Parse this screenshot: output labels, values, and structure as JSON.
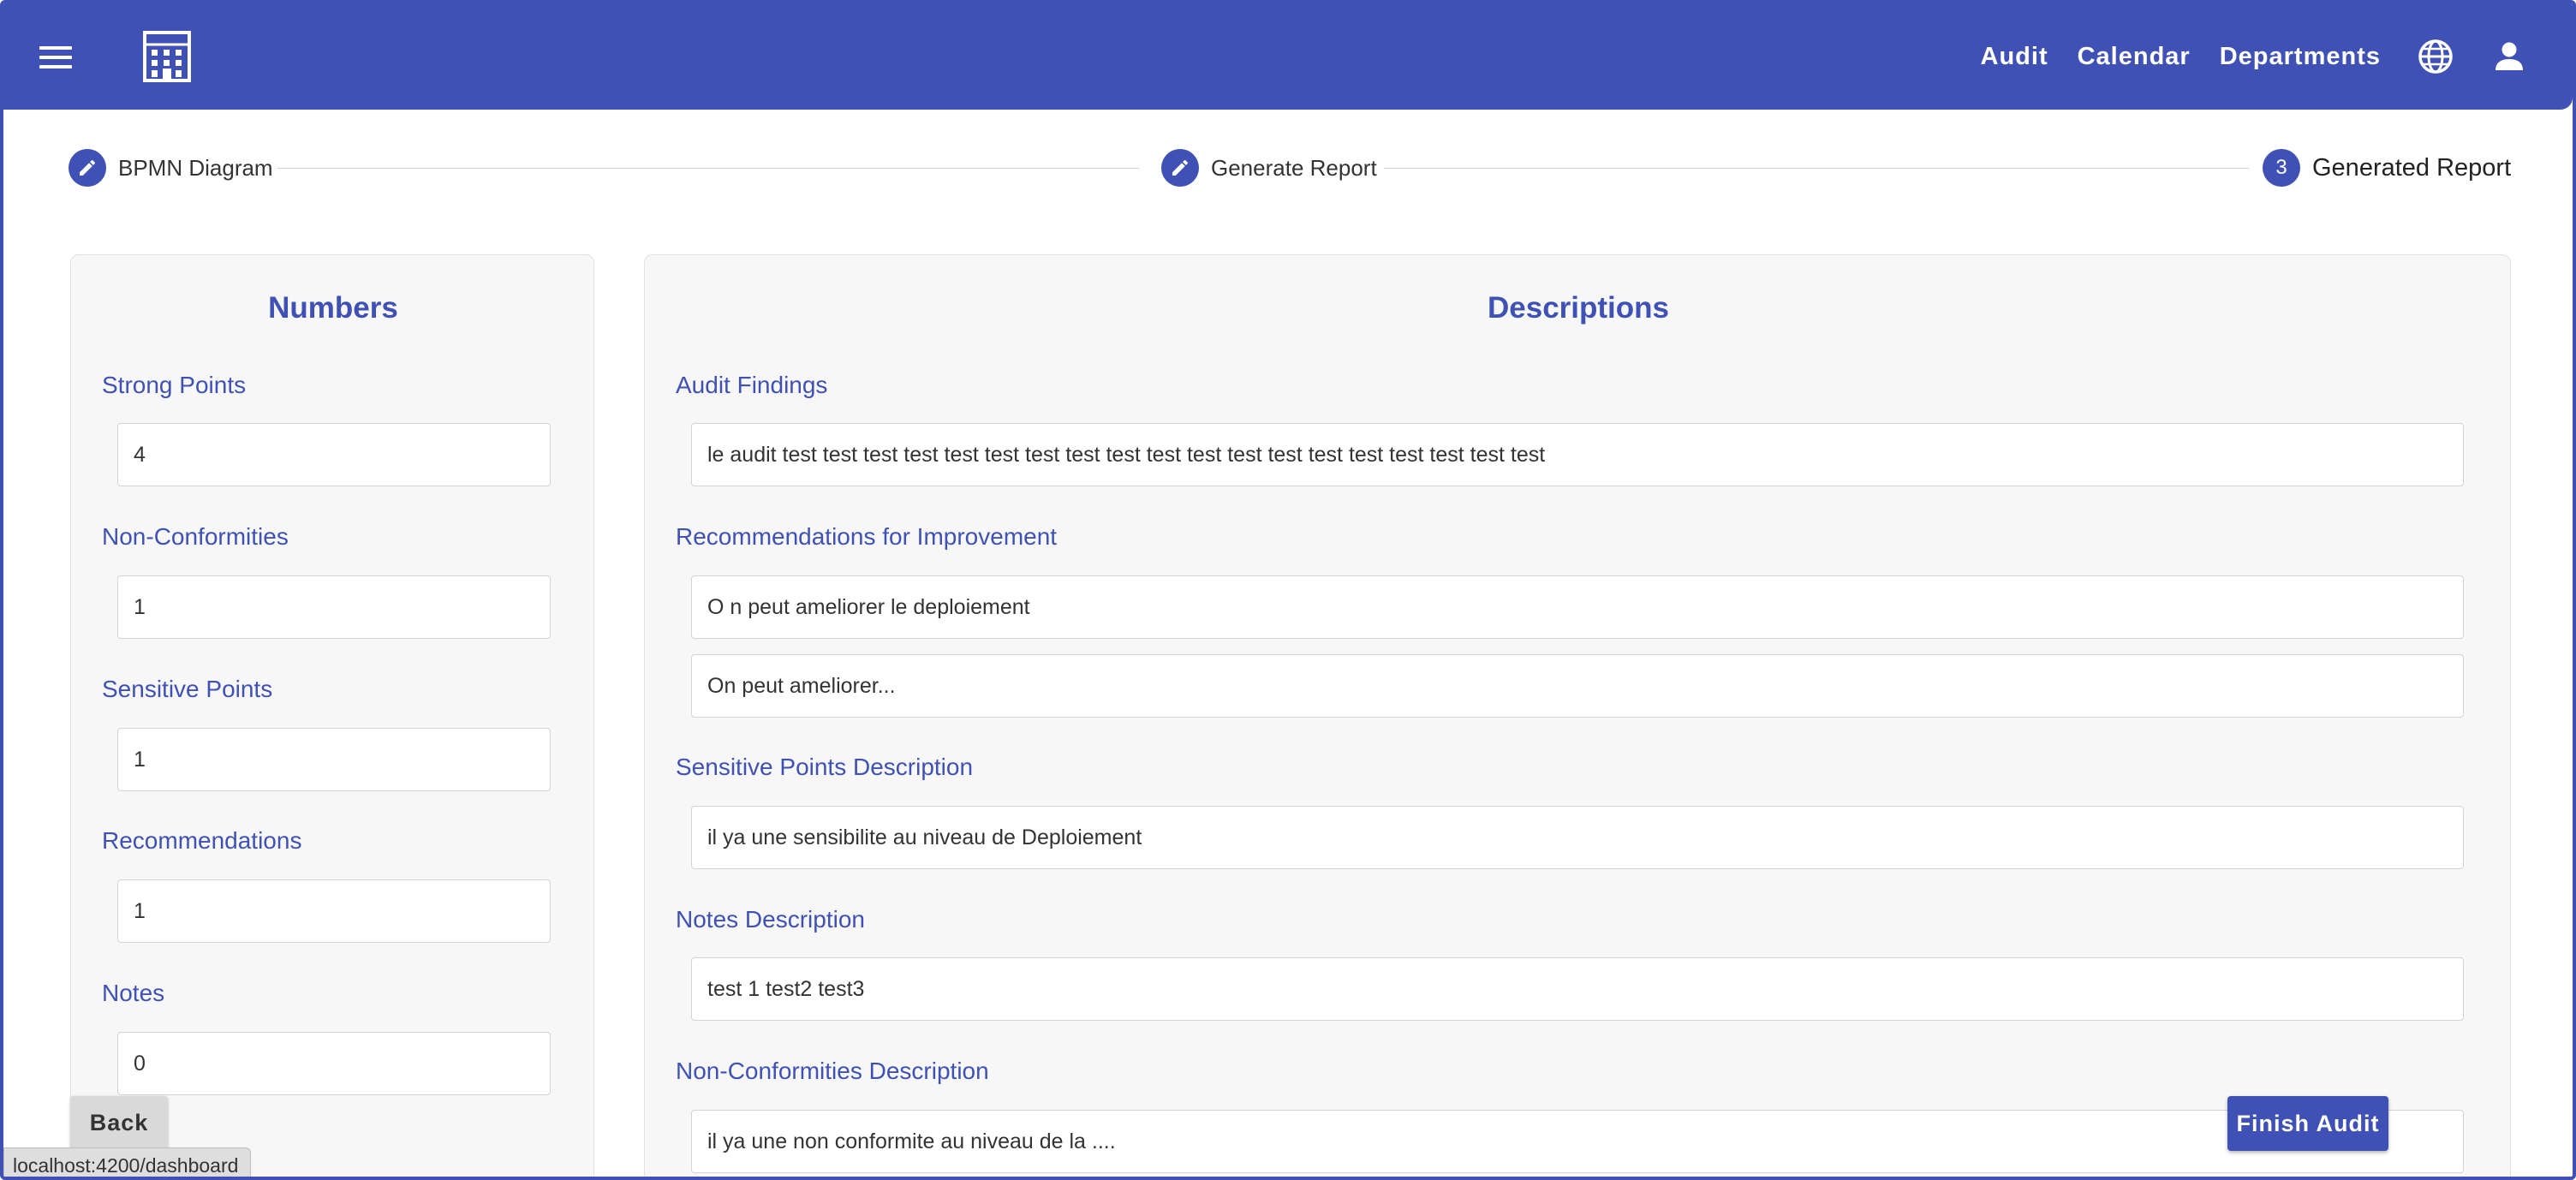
{
  "toolbar": {
    "nav": [
      "Audit",
      "Calendar",
      "Departments"
    ],
    "menu_icon": "hamburger-menu-icon",
    "logo_icon": "building-logo-icon",
    "language_icon": "globe-icon",
    "account_icon": "person-icon"
  },
  "stepper": {
    "steps": [
      {
        "label": "BPMN Diagram",
        "icon": "pencil-edit-icon"
      },
      {
        "label": "Generate Report",
        "icon": "pencil-edit-icon"
      },
      {
        "label": "Generated Report",
        "number": "3"
      }
    ]
  },
  "numbers": {
    "title": "Numbers",
    "fields": [
      {
        "label": "Strong Points",
        "value": "4"
      },
      {
        "label": "Non-Conformities",
        "value": "1"
      },
      {
        "label": "Sensitive Points",
        "value": "1"
      },
      {
        "label": "Recommendations",
        "value": "1"
      },
      {
        "label": "Notes",
        "value": "0"
      }
    ]
  },
  "descriptions": {
    "title": "Descriptions",
    "audit_findings_label": "Audit Findings",
    "audit_findings_value": "le audit test test test test test test test test test test test test test test test test test test test",
    "recommendations_label": "Recommendations for Improvement",
    "recommendations_values": [
      "O n peut ameliorer le deploiement",
      "On peut ameliorer..."
    ],
    "sensitive_label": "Sensitive Points Description",
    "sensitive_value": "il ya une sensibilite au niveau de Deploiement",
    "notes_label": "Notes Description",
    "notes_value": "test 1 test2 test3",
    "nonconf_label": "Non-Conformities Description",
    "nonconf_value": "il ya une non conformite au niveau de la ...."
  },
  "buttons": {
    "back": "Back",
    "finish": "Finish Audit"
  },
  "status_bar": {
    "url": "localhost:4200/dashboard"
  },
  "colors": {
    "primary": "#3f51b5",
    "card_bg": "#f7f7f7",
    "back_button": "#d9d9d9"
  }
}
